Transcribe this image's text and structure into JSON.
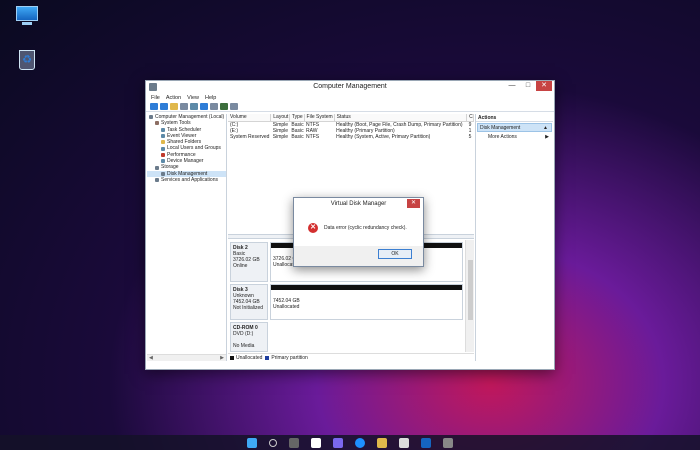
{
  "window": {
    "title": "Computer Management",
    "controls": {
      "minimize": "—",
      "maximize": "□",
      "close": "✕"
    }
  },
  "menu": [
    "File",
    "Action",
    "View",
    "Help"
  ],
  "tree": [
    {
      "label": "Computer Management (Local)",
      "indent": 0,
      "icon_color": "#6b7b8b"
    },
    {
      "label": "System Tools",
      "indent": 1,
      "icon_color": "#8d6e63"
    },
    {
      "label": "Task Scheduler",
      "indent": 2,
      "icon_color": "#5d8aa8"
    },
    {
      "label": "Event Viewer",
      "indent": 2,
      "icon_color": "#5d8aa8"
    },
    {
      "label": "Shared Folders",
      "indent": 2,
      "icon_color": "#e0b84b"
    },
    {
      "label": "Local Users and Groups",
      "indent": 2,
      "icon_color": "#5d8aa8"
    },
    {
      "label": "Performance",
      "indent": 2,
      "icon_color": "#c0392b"
    },
    {
      "label": "Device Manager",
      "indent": 2,
      "icon_color": "#5d8aa8"
    },
    {
      "label": "Storage",
      "indent": 1,
      "icon_color": "#6b7b8b"
    },
    {
      "label": "Disk Management",
      "indent": 2,
      "icon_color": "#6b7b8b",
      "selected": true
    },
    {
      "label": "Services and Applications",
      "indent": 1,
      "icon_color": "#6b7b8b"
    }
  ],
  "volumes": {
    "headers": [
      "Volume",
      "Layout",
      "Type",
      "File System",
      "Status",
      "C"
    ],
    "rows": [
      [
        "(C:)",
        "Simple",
        "Basic",
        "NTFS",
        "Healthy (Boot, Page File, Crash Dump, Primary Partition)",
        "9"
      ],
      [
        "(E:)",
        "Simple",
        "Basic",
        "RAW",
        "Healthy (Primary Partition)",
        "1"
      ],
      [
        "System Reserved",
        "Simple",
        "Basic",
        "NTFS",
        "Healthy (System, Active, Primary Partition)",
        "5"
      ]
    ]
  },
  "disks": [
    {
      "name": "Disk 2",
      "line2": "Basic",
      "line3": "3726.02 GB",
      "line4": "Online",
      "part1": "3726.02 GB",
      "part2": "Unallocated"
    },
    {
      "name": "Disk 3",
      "line2": "Unknown",
      "line3": "7452.04 GB",
      "line4": "Not Initialized",
      "part1": "7452.04 GB",
      "part2": "Unallocated"
    },
    {
      "name": "CD-ROM 0",
      "line2": "DVD (D:)",
      "line3": "",
      "line4": "No Media",
      "part1": "",
      "part2": ""
    }
  ],
  "legend": {
    "unallocated": "Unallocated",
    "primary": "Primary partition"
  },
  "actions": {
    "header": "Actions",
    "section": "Disk Management",
    "more": "More Actions"
  },
  "dialog": {
    "title": "Virtual Disk Manager",
    "message": "Data error (cyclic redundancy check).",
    "ok": "OK"
  },
  "colors": {
    "accent": "#3c7fd1",
    "error": "#d32f2f"
  }
}
